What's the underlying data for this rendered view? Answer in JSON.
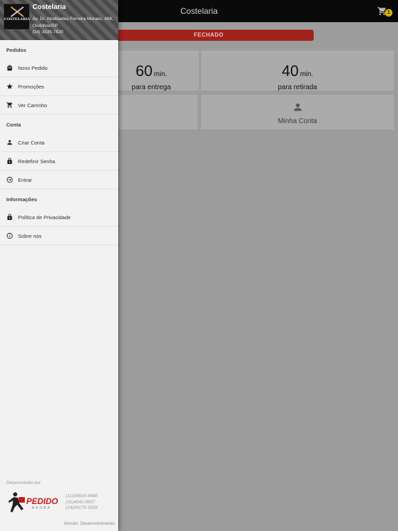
{
  "topbar": {
    "title": "Costelaria",
    "cart_count": "1"
  },
  "status": {
    "label": "FECHADO"
  },
  "times": {
    "delivery": {
      "value": "60",
      "unit": "min.",
      "label": "para entrega"
    },
    "pickup": {
      "value": "40",
      "unit": "min.",
      "label": "para retirada"
    }
  },
  "actions": {
    "account_label": "Minha Conta"
  },
  "drawer": {
    "logo_text": "COSTELARIA",
    "store_name": "Costelaria",
    "address": "Av. Dr. Alcebíades Ferreira Moraes, 488, Ourinhos/SP",
    "phone": "(14) 3335-7820",
    "sections": {
      "orders": "Pedidos",
      "account": "Conta",
      "info": "Informações"
    },
    "items": {
      "new_order": "Novo Pedido",
      "promotions": "Promoções",
      "cart": "Ver Carrinho",
      "create_account": "Criar Conta",
      "reset_password": "Redefinir Senha",
      "login": "Entrar",
      "privacy": "Política de Privacidade",
      "about": "Sobre nós"
    },
    "footer": {
      "developed_by": "Desenvolvido por",
      "brand": "PEDIDO",
      "brand_sub": "AGORA",
      "phones": [
        "(11)99604-9488",
        "(31)4042-9597",
        "(14)99175-3058"
      ],
      "version": "Versão: Desenvolvimento"
    }
  },
  "colors": {
    "topbar": "#0a0a0a",
    "status_closed": "#a2221d",
    "drawer_bg": "#f2f2f2",
    "overlay": "#9c9c9c",
    "brand_red": "#c8191d"
  }
}
